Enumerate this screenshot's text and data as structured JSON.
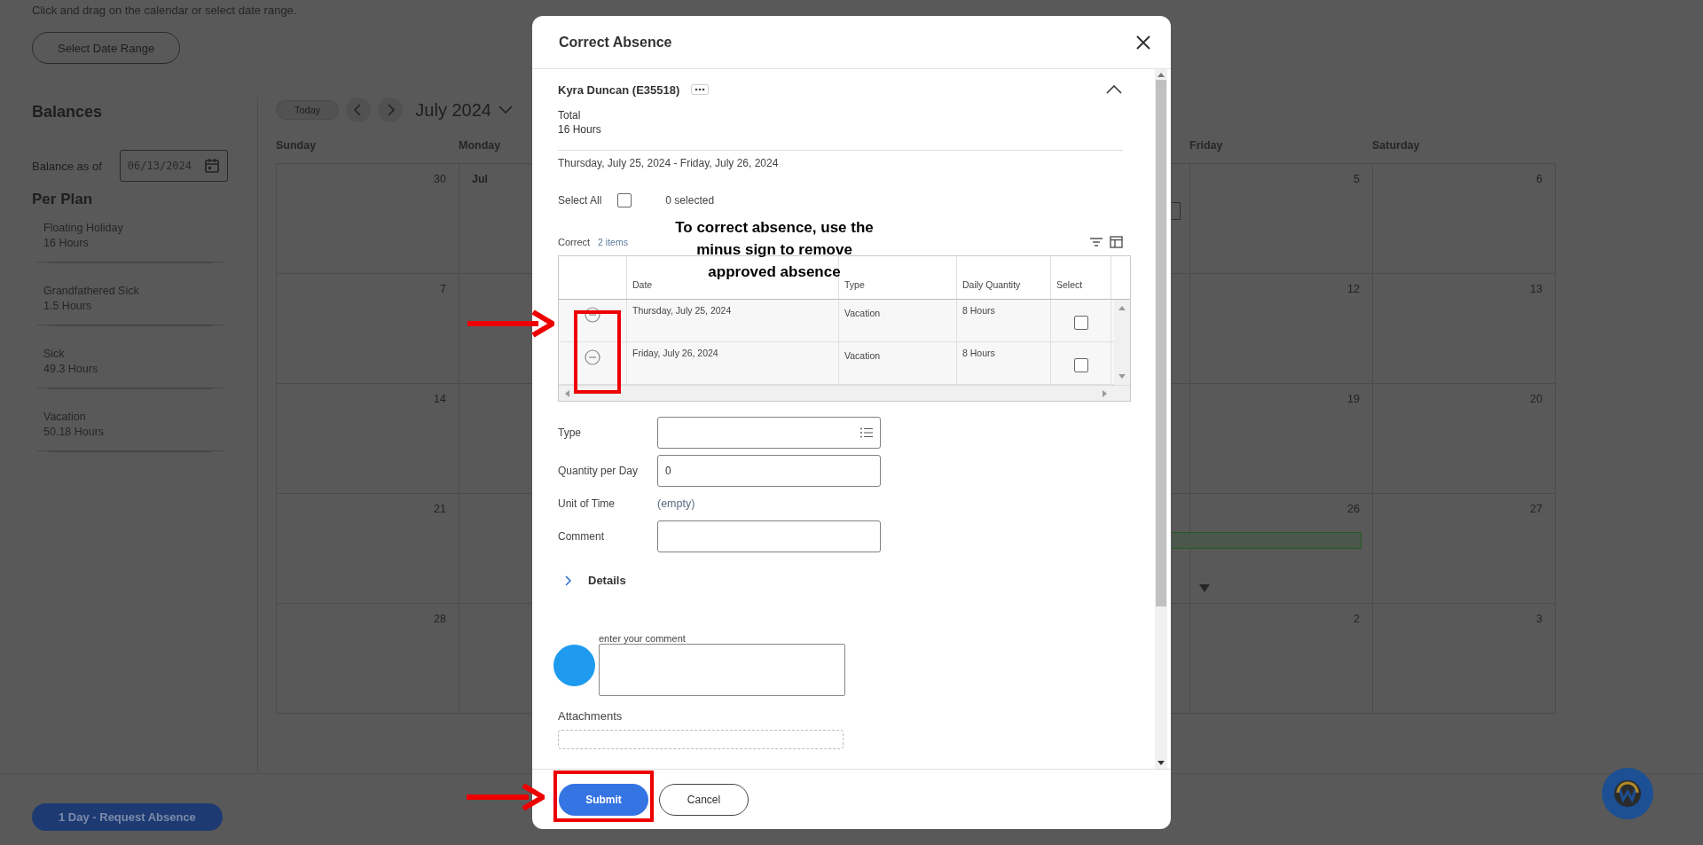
{
  "page": {
    "instruction": "Click and drag on the calendar or select date range.",
    "select_range_button": "Select Date Range",
    "request_button": "1 Day - Request Absence"
  },
  "balances": {
    "title": "Balances",
    "as_of_label": "Balance as of",
    "as_of_value": "06/13/2024",
    "section": "Per Plan",
    "plans": [
      {
        "name": "Floating Holiday",
        "amount": "16 Hours"
      },
      {
        "name": "Grandfathered Sick",
        "amount": "1.5 Hours"
      },
      {
        "name": "Sick",
        "amount": "49.3 Hours"
      },
      {
        "name": "Vacation",
        "amount": "50.18 Hours"
      }
    ]
  },
  "calendar": {
    "today_button": "Today",
    "month": "July 2024",
    "weekdays": {
      "sunday": "Sunday",
      "monday": "Monday",
      "friday": "Friday",
      "saturday": "Saturday"
    },
    "weeks": [
      {
        "sunday": {
          "text": "30",
          "month_start": false
        },
        "monday": {
          "text": "Jul",
          "month_start": true
        },
        "friday": {
          "text": "5",
          "month_start": false
        },
        "saturday": {
          "text": "6",
          "month_start": false
        },
        "events": [
          {
            "kind": "outline"
          }
        ]
      },
      {
        "sunday": {
          "text": "7",
          "month_start": false
        },
        "friday": {
          "text": "12",
          "month_start": false
        },
        "saturday": {
          "text": "13",
          "month_start": false
        }
      },
      {
        "sunday": {
          "text": "14",
          "month_start": false
        },
        "friday": {
          "text": "19",
          "month_start": false
        },
        "saturday": {
          "text": "20",
          "month_start": false
        }
      },
      {
        "sunday": {
          "text": "21",
          "month_start": false
        },
        "friday": {
          "text": "26",
          "month_start": false
        },
        "saturday": {
          "text": "27",
          "month_start": false
        },
        "events": [
          {
            "kind": "bar"
          },
          {
            "kind": "more"
          }
        ]
      },
      {
        "sunday": {
          "text": "28",
          "month_start": false
        },
        "friday": {
          "text": "2",
          "month_start": false
        },
        "saturday": {
          "text": "3",
          "month_start": false
        }
      }
    ]
  },
  "modal": {
    "title": "Correct Absence",
    "worker": "Kyra Duncan (E35518)",
    "expanded": true,
    "total_label": "Total",
    "total_value": "16 Hours",
    "date_range": "Thursday, July 25, 2024 - Friday, July 26, 2024",
    "select_all_label": "Select All",
    "select_all_checked": false,
    "selected_count": "0 selected",
    "grid": {
      "title": "Correct",
      "count": "2 items",
      "columns": [
        "Date",
        "Type",
        "Daily Quantity",
        "Select"
      ],
      "rows": [
        {
          "date": "Thursday, July 25, 2024",
          "type": "Vacation",
          "quantity": "8 Hours",
          "selected": false
        },
        {
          "date": "Friday, July 26, 2024",
          "type": "Vacation",
          "quantity": "8 Hours",
          "selected": false
        }
      ]
    },
    "fields": [
      {
        "kind": "prompt",
        "label": "Type"
      },
      {
        "kind": "text",
        "label": "Quantity per Day",
        "value": "0"
      },
      {
        "kind": "static",
        "label": "Unit of Time",
        "value": "(empty)"
      },
      {
        "kind": "text",
        "label": "Comment"
      }
    ],
    "details": {
      "label": "Details",
      "expanded": false
    },
    "comment_label": "enter your comment",
    "attachments_label": "Attachments",
    "buttons": [
      {
        "kind": "primary",
        "label": "Submit"
      },
      {
        "kind": "secondary",
        "label": "Cancel"
      }
    ]
  },
  "annotation": {
    "text": "To correct absence, use the minus sign to remove approved absence"
  }
}
